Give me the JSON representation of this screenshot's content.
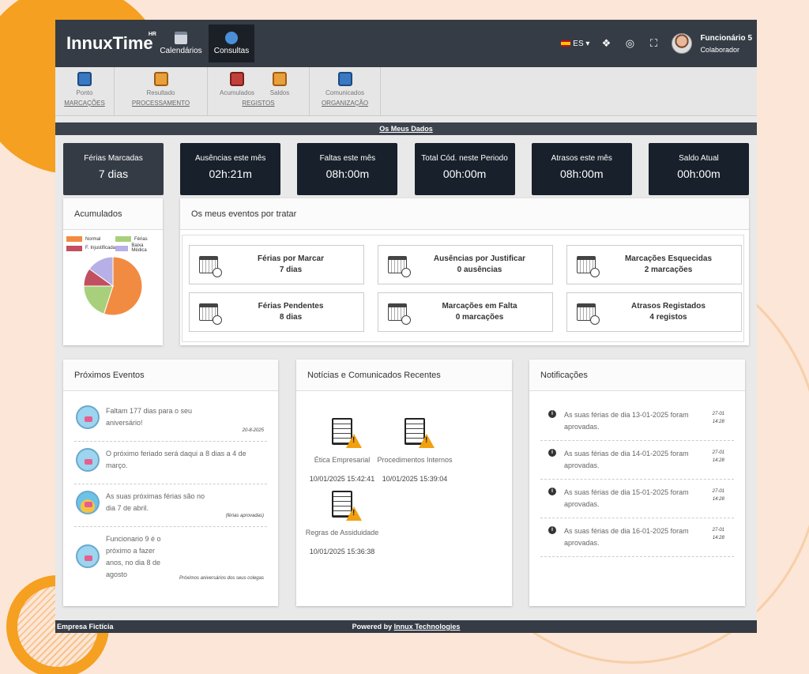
{
  "app": {
    "name": "InnuxTime",
    "sup": "HR"
  },
  "topnav": [
    {
      "label": "Calendários"
    },
    {
      "label": "Consultas"
    }
  ],
  "lang": "ES",
  "user": {
    "name": "Funcionário 5",
    "role": "Colaborador"
  },
  "subnav": [
    {
      "group": "MARCAÇÕES",
      "buttons": [
        "Ponto"
      ]
    },
    {
      "group": "PROCESSAMENTO",
      "buttons": [
        "Resultado"
      ]
    },
    {
      "group": "REGISTOS",
      "buttons": [
        "Acumulados",
        "Saldos"
      ]
    },
    {
      "group": "ORGANIZAÇÃO",
      "buttons": [
        "Comunicados"
      ]
    }
  ],
  "section_title": "Os Meus Dados",
  "stats": [
    {
      "title": "Férias Marcadas",
      "value": "7 dias"
    },
    {
      "title": "Ausências este mês",
      "value": "02h:21m"
    },
    {
      "title": "Faltas este mês",
      "value": "08h:00m"
    },
    {
      "title": "Total Cód. neste Periodo",
      "value": "00h:00m"
    },
    {
      "title": "Atrasos este mês",
      "value": "08h:00m"
    },
    {
      "title": "Saldo Atual",
      "value": "00h:00m"
    }
  ],
  "accum": {
    "title": "Acumulados",
    "legend": [
      {
        "name": "Normal",
        "color": "#f28b42"
      },
      {
        "name": "Férias",
        "color": "#a8d07c"
      },
      {
        "name": "F. Injustificada",
        "color": "#c24f5f"
      },
      {
        "name": "Baixa Médica",
        "color": "#b7b0e6"
      }
    ]
  },
  "chart_data": {
    "type": "pie",
    "categories": [
      "Normal",
      "Férias",
      "F. Injustificada",
      "Baixa Médica"
    ],
    "values": [
      55,
      20,
      10,
      15
    ],
    "colors": [
      "#f28b42",
      "#a8d07c",
      "#c24f5f",
      "#b7b0e6"
    ]
  },
  "pending": {
    "title": "Os meus eventos por tratar",
    "items": [
      {
        "title": "Férias por Marcar",
        "value": "7 dias"
      },
      {
        "title": "Ausências por Justificar",
        "value": "0 ausências"
      },
      {
        "title": "Marcações Esquecidas",
        "value": "2 marcações"
      },
      {
        "title": "Férias Pendentes",
        "value": "8 dias"
      },
      {
        "title": "Marcações em Falta",
        "value": "0 marcações"
      },
      {
        "title": "Atrasos Registados",
        "value": "4 registos"
      }
    ]
  },
  "upcoming": {
    "title": "Próximos Eventos",
    "items": [
      {
        "text": "Faltam 177 dias para o seu aniversário!",
        "note": "20-8-2025"
      },
      {
        "text": "O próximo feriado será daqui a 8 dias a 4 de março.",
        "note": ""
      },
      {
        "text": "As suas próximas férias são no dia 7 de abril.",
        "note": "(férias aprovadas)"
      },
      {
        "text": "Funcionario 9 é o próximo a fazer anos, no dia 8 de agosto",
        "note": "Próximos aniversários dos seus colegas"
      }
    ]
  },
  "news": {
    "title": "Notícias e Comunicados Recentes",
    "items": [
      {
        "title": "Ética Empresarial",
        "date": "10/01/2025 15:42:41"
      },
      {
        "title": "Procedimentos Internos",
        "date": "10/01/2025 15:39:04"
      },
      {
        "title": "Regras de Assiduidade",
        "date": "10/01/2025 15:36:38"
      }
    ]
  },
  "notifications": {
    "title": "Notificações",
    "items": [
      {
        "text": "As suas férias de dia 13-01-2025 foram aprovadas.",
        "date": "27-01",
        "time": "14:28"
      },
      {
        "text": "As suas férias de dia 14-01-2025 foram aprovadas.",
        "date": "27-01",
        "time": "14:28"
      },
      {
        "text": "As suas férias de dia 15-01-2025 foram aprovadas.",
        "date": "27-01",
        "time": "14:28"
      },
      {
        "text": "As suas férias de dia 16-01-2025 foram aprovadas.",
        "date": "27-01",
        "time": "14:28"
      }
    ]
  },
  "footer": {
    "company": "Empresa Fictícia",
    "powered": "Powered by",
    "powered_link": "Innux Technologies"
  }
}
